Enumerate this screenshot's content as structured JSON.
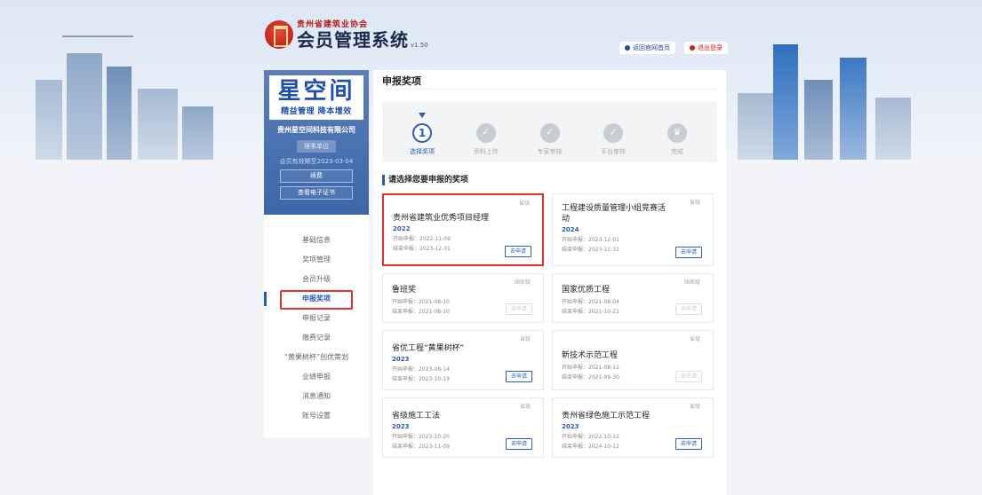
{
  "header": {
    "association": "贵州省建筑业协会",
    "system_name": "会员管理系统",
    "version": "v1.50",
    "home_link": "返回官网首页",
    "logout_link": "退出登录"
  },
  "profile": {
    "brand_name": "星空间",
    "slogan": "精益管理 降本增效",
    "company": "贵州星空间科技有限公司",
    "member_tag": "理事单位",
    "expire": "会员有效期至2023-03-04",
    "renew_button": "续费",
    "certificate_button": "查看电子证书"
  },
  "menu": [
    {
      "label": "基础信息",
      "active": false
    },
    {
      "label": "奖项管理",
      "active": false
    },
    {
      "label": "会员升级",
      "active": false
    },
    {
      "label": "申报奖项",
      "active": true
    },
    {
      "label": "申报记录",
      "active": false
    },
    {
      "label": "缴费记录",
      "active": false
    },
    {
      "label": "“黄果树杯”创优策划",
      "active": false
    },
    {
      "label": "业绩申报",
      "active": false
    },
    {
      "label": "消息通知",
      "active": false
    },
    {
      "label": "账号设置",
      "active": false
    }
  ],
  "main": {
    "title": "申报奖项",
    "steps": [
      {
        "label": "选择奖项",
        "num": "1",
        "current": true
      },
      {
        "label": "资料上传",
        "num": "✓",
        "current": false
      },
      {
        "label": "专家审核",
        "num": "✓",
        "current": false
      },
      {
        "label": "平台审核",
        "num": "✓",
        "current": false
      },
      {
        "label": "完成",
        "num": "♛",
        "current": false
      }
    ],
    "section_title": "请选择您要申报的奖项",
    "start_prefix": "开始申报：",
    "end_prefix": "结束申报：",
    "apply_label": "去申请",
    "awards": [
      {
        "name": "贵州省建筑业优秀项目经理",
        "year": "2022",
        "level": "省级",
        "start": "2022-11-09",
        "end": "2023-12-31",
        "enabled": true
      },
      {
        "name": "工程建设质量管理小组竞赛活动",
        "year": "2024",
        "level": "省级",
        "start": "2023-12-01",
        "end": "2023-12-31",
        "enabled": true
      },
      {
        "name": "鲁班奖",
        "year": "",
        "level": "国家级",
        "start": "2021-08-10",
        "end": "2021-08-10",
        "enabled": false
      },
      {
        "name": "国家优质工程",
        "year": "",
        "level": "国家级",
        "start": "2021-08-04",
        "end": "2021-10-22",
        "enabled": false
      },
      {
        "name": "省优工程“黄果树杯”",
        "year": "2023",
        "level": "省级",
        "start": "2023-08-14",
        "end": "2023-10-19",
        "enabled": true
      },
      {
        "name": "新技术示范工程",
        "year": "",
        "level": "省级",
        "start": "2021-08-12",
        "end": "2021-09-30",
        "enabled": false
      },
      {
        "name": "省级施工工法",
        "year": "2023",
        "level": "省级",
        "start": "2023-10-20",
        "end": "2023-11-09",
        "enabled": true
      },
      {
        "name": "贵州省绿色施工示范工程",
        "year": "2023",
        "level": "省级",
        "start": "2022-10-12",
        "end": "2024-10-12",
        "enabled": true
      }
    ]
  }
}
